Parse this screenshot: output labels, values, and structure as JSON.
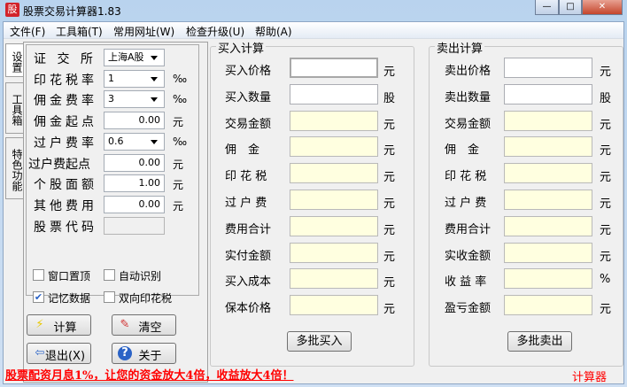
{
  "window": {
    "title": "股票交易计算器1.83",
    "icon_text": "股",
    "minimize": "—",
    "maximize": "□",
    "close": "✕"
  },
  "menu": [
    "文件(F)",
    "工具箱(T)",
    "常用网址(W)",
    "检查升级(U)",
    "帮助(A)"
  ],
  "tabs": [
    "设置",
    "工具箱",
    "特色功能"
  ],
  "settings": {
    "rows": [
      {
        "label": "证 交 所",
        "value": "上海A股",
        "type": "select",
        "unit": ""
      },
      {
        "label": "印花税率",
        "value": "1",
        "type": "select",
        "unit": "‰"
      },
      {
        "label": "佣金费率",
        "value": "3",
        "type": "select",
        "unit": "‰"
      },
      {
        "label": "佣金起点",
        "value": "0.00",
        "type": "input",
        "unit": "元"
      },
      {
        "label": "过户费率",
        "value": "0.6",
        "type": "select",
        "unit": "‰"
      },
      {
        "label": "过户费起点",
        "value": "0.00",
        "type": "input",
        "unit": "元"
      },
      {
        "label": "个股面额",
        "value": "1.00",
        "type": "input",
        "unit": "元"
      },
      {
        "label": "其他费用",
        "value": "0.00",
        "type": "input",
        "unit": "元"
      },
      {
        "label": "股票代码",
        "value": "",
        "type": "disabled",
        "unit": ""
      }
    ],
    "checkboxes": [
      {
        "label": "窗口置顶",
        "checked": false
      },
      {
        "label": "自动识别",
        "checked": false
      },
      {
        "label": "记忆数据",
        "checked": true
      },
      {
        "label": "双向印花税",
        "checked": false
      }
    ]
  },
  "buttons": {
    "calc": "计算",
    "clear": "清空",
    "exit": "退出(X)",
    "about": "关于"
  },
  "buy": {
    "title": "买入计算",
    "button": "多批买入",
    "rows": [
      {
        "label": "买入价格",
        "unit": "元",
        "editable": true
      },
      {
        "label": "买入数量",
        "unit": "股",
        "editable": true
      },
      {
        "label": "交易金额",
        "unit": "元",
        "editable": false
      },
      {
        "label": "佣　金",
        "unit": "元",
        "editable": false
      },
      {
        "label": "印 花 税",
        "unit": "元",
        "editable": false
      },
      {
        "label": "过 户 费",
        "unit": "元",
        "editable": false
      },
      {
        "label": "费用合计",
        "unit": "元",
        "editable": false
      },
      {
        "label": "实付金额",
        "unit": "元",
        "editable": false
      },
      {
        "label": "买入成本",
        "unit": "元",
        "editable": false
      },
      {
        "label": "保本价格",
        "unit": "元",
        "editable": false
      }
    ]
  },
  "sell": {
    "title": "卖出计算",
    "button": "多批卖出",
    "rows": [
      {
        "label": "卖出价格",
        "unit": "元",
        "editable": true
      },
      {
        "label": "卖出数量",
        "unit": "股",
        "editable": true
      },
      {
        "label": "交易金额",
        "unit": "元",
        "editable": false
      },
      {
        "label": "佣　金",
        "unit": "元",
        "editable": false
      },
      {
        "label": "印 花 税",
        "unit": "元",
        "editable": false
      },
      {
        "label": "过 户 费",
        "unit": "元",
        "editable": false
      },
      {
        "label": "费用合计",
        "unit": "元",
        "editable": false
      },
      {
        "label": "实收金额",
        "unit": "元",
        "editable": false
      },
      {
        "label": "收 益 率",
        "unit": "%",
        "editable": false
      },
      {
        "label": "盈亏金额",
        "unit": "元",
        "editable": false
      }
    ]
  },
  "footer": {
    "promo": "股票配资月息1%，让您的资金放大4倍，收益放大4倍！",
    "status": "计算器"
  }
}
